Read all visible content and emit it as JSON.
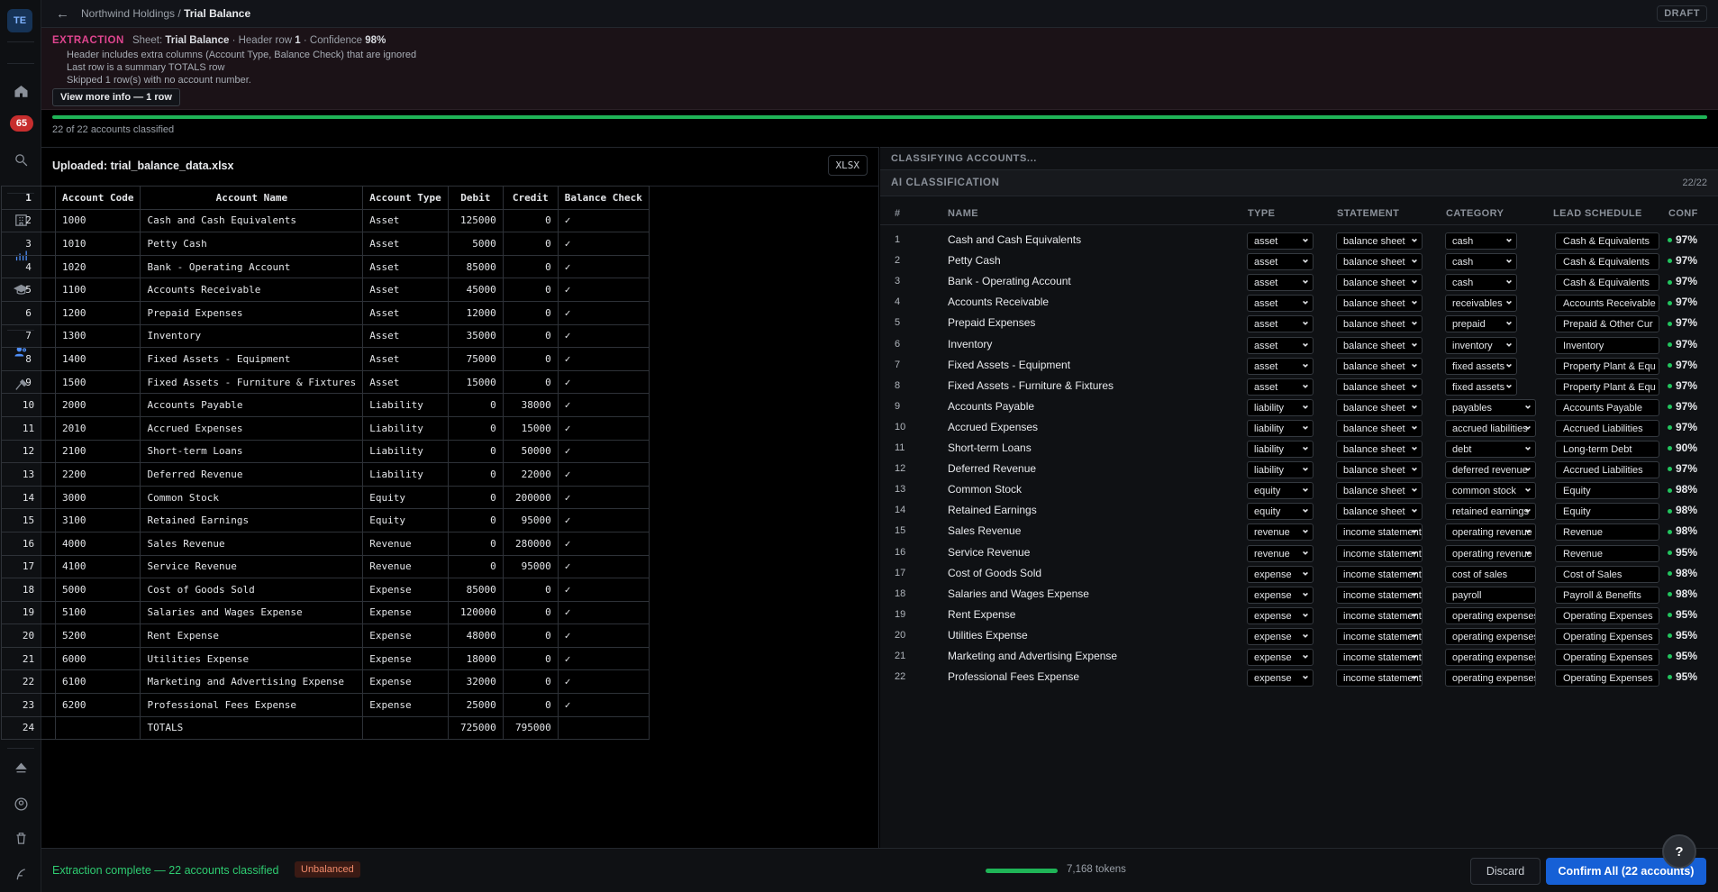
{
  "rail": {
    "avatar": "TE",
    "notification_count": "65"
  },
  "topbar": {
    "breadcrumb_parent": "Northwind Holdings",
    "breadcrumb_sep": "/",
    "breadcrumb_current": "Trial Balance",
    "status": "DRAFT"
  },
  "extraction": {
    "tag": "EXTRACTION",
    "sheet_label": "Sheet:",
    "sheet": "Trial Balance",
    "header_label": "· Header row",
    "header_row": "1",
    "confidence_label": "· Confidence",
    "confidence": "98%",
    "notes": [
      "Header includes extra columns (Account Type, Balance Check) that are ignored",
      "Last row is a summary TOTALS row",
      "Skipped 1 row(s) with no account number."
    ],
    "view_more": "View more info — 1 row"
  },
  "progress": {
    "fraction": 1.0,
    "label": "22 of 22 accounts classified"
  },
  "upload": {
    "title": "Uploaded: trial_balance_data.xlsx",
    "format": "XLSX"
  },
  "sheet": [
    [
      "1",
      "Account Code",
      "Account Name",
      "Account Type",
      "Debit",
      "Credit",
      "Balance Check"
    ],
    [
      "2",
      "1000",
      "Cash and Cash Equivalents",
      "Asset",
      "125000",
      "0",
      "✓"
    ],
    [
      "3",
      "1010",
      "Petty Cash",
      "Asset",
      "5000",
      "0",
      "✓"
    ],
    [
      "4",
      "1020",
      "Bank - Operating Account",
      "Asset",
      "85000",
      "0",
      "✓"
    ],
    [
      "5",
      "1100",
      "Accounts Receivable",
      "Asset",
      "45000",
      "0",
      "✓"
    ],
    [
      "6",
      "1200",
      "Prepaid Expenses",
      "Asset",
      "12000",
      "0",
      "✓"
    ],
    [
      "7",
      "1300",
      "Inventory",
      "Asset",
      "35000",
      "0",
      "✓"
    ],
    [
      "8",
      "1400",
      "Fixed Assets - Equipment",
      "Asset",
      "75000",
      "0",
      "✓"
    ],
    [
      "9",
      "1500",
      "Fixed Assets - Furniture & Fixtures",
      "Asset",
      "15000",
      "0",
      "✓"
    ],
    [
      "10",
      "2000",
      "Accounts Payable",
      "Liability",
      "0",
      "38000",
      "✓"
    ],
    [
      "11",
      "2010",
      "Accrued Expenses",
      "Liability",
      "0",
      "15000",
      "✓"
    ],
    [
      "12",
      "2100",
      "Short-term Loans",
      "Liability",
      "0",
      "50000",
      "✓"
    ],
    [
      "13",
      "2200",
      "Deferred Revenue",
      "Liability",
      "0",
      "22000",
      "✓"
    ],
    [
      "14",
      "3000",
      "Common Stock",
      "Equity",
      "0",
      "200000",
      "✓"
    ],
    [
      "15",
      "3100",
      "Retained Earnings",
      "Equity",
      "0",
      "95000",
      "✓"
    ],
    [
      "16",
      "4000",
      "Sales Revenue",
      "Revenue",
      "0",
      "280000",
      "✓"
    ],
    [
      "17",
      "4100",
      "Service Revenue",
      "Revenue",
      "0",
      "95000",
      "✓"
    ],
    [
      "18",
      "5000",
      "Cost of Goods Sold",
      "Expense",
      "85000",
      "0",
      "✓"
    ],
    [
      "19",
      "5100",
      "Salaries and Wages Expense",
      "Expense",
      "120000",
      "0",
      "✓"
    ],
    [
      "20",
      "5200",
      "Rent Expense",
      "Expense",
      "48000",
      "0",
      "✓"
    ],
    [
      "21",
      "6000",
      "Utilities Expense",
      "Expense",
      "18000",
      "0",
      "✓"
    ],
    [
      "22",
      "6100",
      "Marketing and Advertising Expense",
      "Expense",
      "32000",
      "0",
      "✓"
    ],
    [
      "23",
      "6200",
      "Professional Fees Expense",
      "Expense",
      "25000",
      "0",
      "✓"
    ],
    [
      "24",
      "",
      "TOTALS",
      "",
      "725000",
      "795000",
      ""
    ]
  ],
  "classifying_label": "CLASSIFYING ACCOUNTS...",
  "ai": {
    "title": "AI CLASSIFICATION",
    "count": "22/22",
    "columns": [
      "#",
      "NAME",
      "TYPE",
      "STATEMENT",
      "CATEGORY",
      "LEAD SCHEDULE",
      "CONF"
    ],
    "rows": [
      {
        "n": "1",
        "name": "Cash and Cash Equivalents",
        "type": "asset",
        "statement": "balance sheet",
        "category": "cash",
        "lead": "Cash & Equivalents",
        "conf": "97%"
      },
      {
        "n": "2",
        "name": "Petty Cash",
        "type": "asset",
        "statement": "balance sheet",
        "category": "cash",
        "lead": "Cash & Equivalents",
        "conf": "97%"
      },
      {
        "n": "3",
        "name": "Bank - Operating Account",
        "type": "asset",
        "statement": "balance sheet",
        "category": "cash",
        "lead": "Cash & Equivalents",
        "conf": "97%"
      },
      {
        "n": "4",
        "name": "Accounts Receivable",
        "type": "asset",
        "statement": "balance sheet",
        "category": "receivables",
        "lead": "Accounts Receivable",
        "conf": "97%"
      },
      {
        "n": "5",
        "name": "Prepaid Expenses",
        "type": "asset",
        "statement": "balance sheet",
        "category": "prepaid",
        "lead": "Prepaid & Other Cur",
        "conf": "97%"
      },
      {
        "n": "6",
        "name": "Inventory",
        "type": "asset",
        "statement": "balance sheet",
        "category": "inventory",
        "lead": "Inventory",
        "conf": "97%"
      },
      {
        "n": "7",
        "name": "Fixed Assets - Equipment",
        "type": "asset",
        "statement": "balance sheet",
        "category": "fixed assets",
        "lead": "Property Plant & Equ",
        "conf": "97%"
      },
      {
        "n": "8",
        "name": "Fixed Assets - Furniture & Fixtures",
        "type": "asset",
        "statement": "balance sheet",
        "category": "fixed assets",
        "lead": "Property Plant & Equ",
        "conf": "97%"
      },
      {
        "n": "9",
        "name": "Accounts Payable",
        "type": "liability",
        "statement": "balance sheet",
        "category": "payables",
        "lead": "Accounts Payable",
        "conf": "97%"
      },
      {
        "n": "10",
        "name": "Accrued Expenses",
        "type": "liability",
        "statement": "balance sheet",
        "category": "accrued liabilities",
        "lead": "Accrued Liabilities",
        "conf": "97%"
      },
      {
        "n": "11",
        "name": "Short-term Loans",
        "type": "liability",
        "statement": "balance sheet",
        "category": "debt",
        "lead": "Long-term Debt",
        "conf": "90%"
      },
      {
        "n": "12",
        "name": "Deferred Revenue",
        "type": "liability",
        "statement": "balance sheet",
        "category": "deferred revenue",
        "lead": "Accrued Liabilities",
        "conf": "97%"
      },
      {
        "n": "13",
        "name": "Common Stock",
        "type": "equity",
        "statement": "balance sheet",
        "category": "common stock",
        "lead": "Equity",
        "conf": "98%"
      },
      {
        "n": "14",
        "name": "Retained Earnings",
        "type": "equity",
        "statement": "balance sheet",
        "category": "retained earnings",
        "lead": "Equity",
        "conf": "98%"
      },
      {
        "n": "15",
        "name": "Sales Revenue",
        "type": "revenue",
        "statement": "income statement",
        "category": "operating revenue",
        "lead": "Revenue",
        "conf": "98%"
      },
      {
        "n": "16",
        "name": "Service Revenue",
        "type": "revenue",
        "statement": "income statement",
        "category": "operating revenue",
        "lead": "Revenue",
        "conf": "95%"
      },
      {
        "n": "17",
        "name": "Cost of Goods Sold",
        "type": "expense",
        "statement": "income statement",
        "category": "cost of sales",
        "lead": "Cost of Sales",
        "conf": "98%"
      },
      {
        "n": "18",
        "name": "Salaries and Wages Expense",
        "type": "expense",
        "statement": "income statement",
        "category": "payroll",
        "lead": "Payroll & Benefits",
        "conf": "98%"
      },
      {
        "n": "19",
        "name": "Rent Expense",
        "type": "expense",
        "statement": "income statement",
        "category": "operating expenses",
        "lead": "Operating Expenses",
        "conf": "95%"
      },
      {
        "n": "20",
        "name": "Utilities Expense",
        "type": "expense",
        "statement": "income statement",
        "category": "operating expenses",
        "lead": "Operating Expenses",
        "conf": "95%"
      },
      {
        "n": "21",
        "name": "Marketing and Advertising Expense",
        "type": "expense",
        "statement": "income statement",
        "category": "operating expenses",
        "lead": "Operating Expenses",
        "conf": "95%"
      },
      {
        "n": "22",
        "name": "Professional Fees Expense",
        "type": "expense",
        "statement": "income statement",
        "category": "operating expenses",
        "lead": "Operating Expenses",
        "conf": "95%"
      }
    ]
  },
  "footer": {
    "status": "Extraction complete — 22 accounts classified",
    "badge": "Unbalanced",
    "tokens": "7,168 tokens",
    "discard": "Discard",
    "confirm": "Confirm All (22 accounts)"
  },
  "colors": {
    "accent": "#1660d6",
    "success": "#22c55e",
    "extraction_tag": "#e0458f",
    "warning": "#f28b6b"
  }
}
